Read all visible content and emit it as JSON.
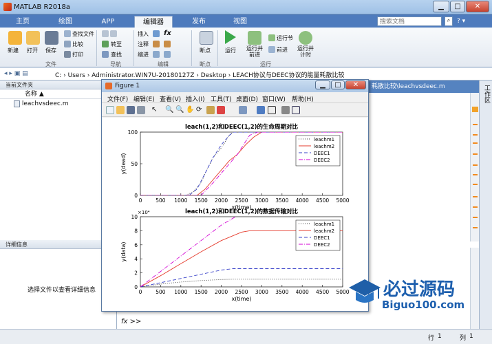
{
  "app": {
    "title": "MATLAB R2018a"
  },
  "ribbon": {
    "tabs": [
      "主页",
      "绘图",
      "APP",
      "编辑器",
      "发布",
      "视图"
    ],
    "search_placeholder": "搜索文档"
  },
  "toolstrip": {
    "file": {
      "new": "新建",
      "open": "打开",
      "save": "保存",
      "find_files": "查找文件",
      "compare": "比较",
      "print": "打印",
      "group": "文件"
    },
    "nav": {
      "goto": "转至",
      "find": "查找",
      "group": "导航"
    },
    "edit": {
      "insert": "插入",
      "comment": "注释",
      "indent": "缩进",
      "fx": "fx",
      "group": "编辑"
    },
    "breakpoints": {
      "label": "断点",
      "group": "断点"
    },
    "run": {
      "run": "运行",
      "run_advance": "运行并\n前进",
      "run_section": "运行节",
      "advance": "前进",
      "run_time": "运行并\n计时",
      "group": "运行"
    }
  },
  "address": {
    "path": "C: › Users › Administrator.WIN7U-20180127Z › Desktop › LEACH协议与DEEC协议的能量耗散比较"
  },
  "current_folder": {
    "title": "当前文件夹",
    "col_name": "名称",
    "sort_arrow": "▲",
    "files": [
      "leachvsdeec.m"
    ]
  },
  "details": {
    "title": "详细信息",
    "hint": "选择文件以查看详细信息"
  },
  "editor": {
    "tab": "耗散比较\\leachvsdeec.m"
  },
  "workspace": {
    "title": "工作区"
  },
  "command": {
    "prompt": "fx >>"
  },
  "status": {
    "row_label": "行",
    "row": "1",
    "col_label": "列",
    "col": "1"
  },
  "figure": {
    "title": "Figure 1",
    "menu": [
      "文件(F)",
      "编辑(E)",
      "查看(V)",
      "插入(I)",
      "工具(T)",
      "桌面(D)",
      "窗口(W)",
      "帮助(H)"
    ]
  },
  "watermark": {
    "brand": "必过源码",
    "url": "Biguo100.com"
  },
  "colors": {
    "leachm1": "#333333",
    "leachm2": "#e53b2c",
    "DEEC1": "#3a43c9",
    "DEEC2": "#d400d4"
  },
  "chart_data": [
    {
      "type": "line",
      "title": "leach(1,2)和DEEC(1,2)的生命周期对比",
      "xlabel": "x(time)",
      "ylabel": "y(dead)",
      "xlim": [
        0,
        5000
      ],
      "ylim": [
        0,
        100
      ],
      "xticks": [
        0,
        500,
        1000,
        1500,
        2000,
        2500,
        3000,
        3500,
        4000,
        4500,
        5000
      ],
      "yticks": [
        0,
        50,
        100
      ],
      "legend_position": "top-right",
      "series": [
        {
          "name": "leachm1",
          "style": "dotted",
          "x": [
            0,
            1100,
            1300,
            1500,
            1600,
            1800,
            2000,
            2100,
            2200,
            2300,
            5000
          ],
          "y": [
            0,
            0,
            5,
            20,
            35,
            60,
            75,
            85,
            95,
            100,
            100
          ]
        },
        {
          "name": "leachm2",
          "style": "solid",
          "x": [
            0,
            1400,
            1600,
            1800,
            2000,
            2200,
            2400,
            2600,
            2800,
            3000,
            5000
          ],
          "y": [
            0,
            0,
            10,
            25,
            40,
            55,
            65,
            80,
            92,
            100,
            100
          ]
        },
        {
          "name": "DEEC1",
          "style": "dashed",
          "x": [
            0,
            1200,
            1400,
            1600,
            1800,
            2000,
            2200,
            2300,
            5000
          ],
          "y": [
            0,
            0,
            10,
            35,
            60,
            80,
            95,
            100,
            100
          ]
        },
        {
          "name": "DEEC2",
          "style": "dashdot",
          "x": [
            0,
            1500,
            1800,
            2000,
            2200,
            2400,
            2600,
            2700,
            2900,
            5000
          ],
          "y": [
            0,
            0,
            20,
            35,
            50,
            65,
            85,
            95,
            100,
            100
          ]
        }
      ]
    },
    {
      "type": "line",
      "title": "leach(1,2)和DEEC(1,2)的数据传输对比",
      "xlabel": "x(time)",
      "ylabel": "y(data)",
      "yexponent": "×10⁴",
      "xlim": [
        0,
        5000
      ],
      "ylim": [
        0,
        10
      ],
      "xticks": [
        0,
        500,
        1000,
        1500,
        2000,
        2500,
        3000,
        3500,
        4000,
        4500,
        5000
      ],
      "yticks": [
        0,
        2,
        4,
        6,
        8,
        10
      ],
      "legend_position": "top-right",
      "series": [
        {
          "name": "leachm1",
          "style": "dotted",
          "x": [
            0,
            500,
            1000,
            1500,
            2000,
            2300,
            5000
          ],
          "y": [
            0,
            0.4,
            0.7,
            0.9,
            1.05,
            1.1,
            1.1
          ]
        },
        {
          "name": "leachm2",
          "style": "solid",
          "x": [
            0,
            500,
            1000,
            1500,
            2000,
            2500,
            2700,
            5000
          ],
          "y": [
            0,
            1.6,
            3.3,
            5.0,
            6.6,
            7.8,
            8.0,
            8.0
          ]
        },
        {
          "name": "DEEC1",
          "style": "dashed",
          "x": [
            0,
            500,
            1000,
            1500,
            2000,
            2300,
            5000
          ],
          "y": [
            0,
            0.6,
            1.2,
            1.8,
            2.4,
            2.6,
            2.6
          ]
        },
        {
          "name": "DEEC2",
          "style": "dashdot",
          "x": [
            0,
            500,
            1000,
            1500,
            2000,
            2500,
            2700,
            5000
          ],
          "y": [
            0,
            2.2,
            4.4,
            6.6,
            8.8,
            10.5,
            10.8,
            10.8
          ]
        }
      ]
    }
  ]
}
